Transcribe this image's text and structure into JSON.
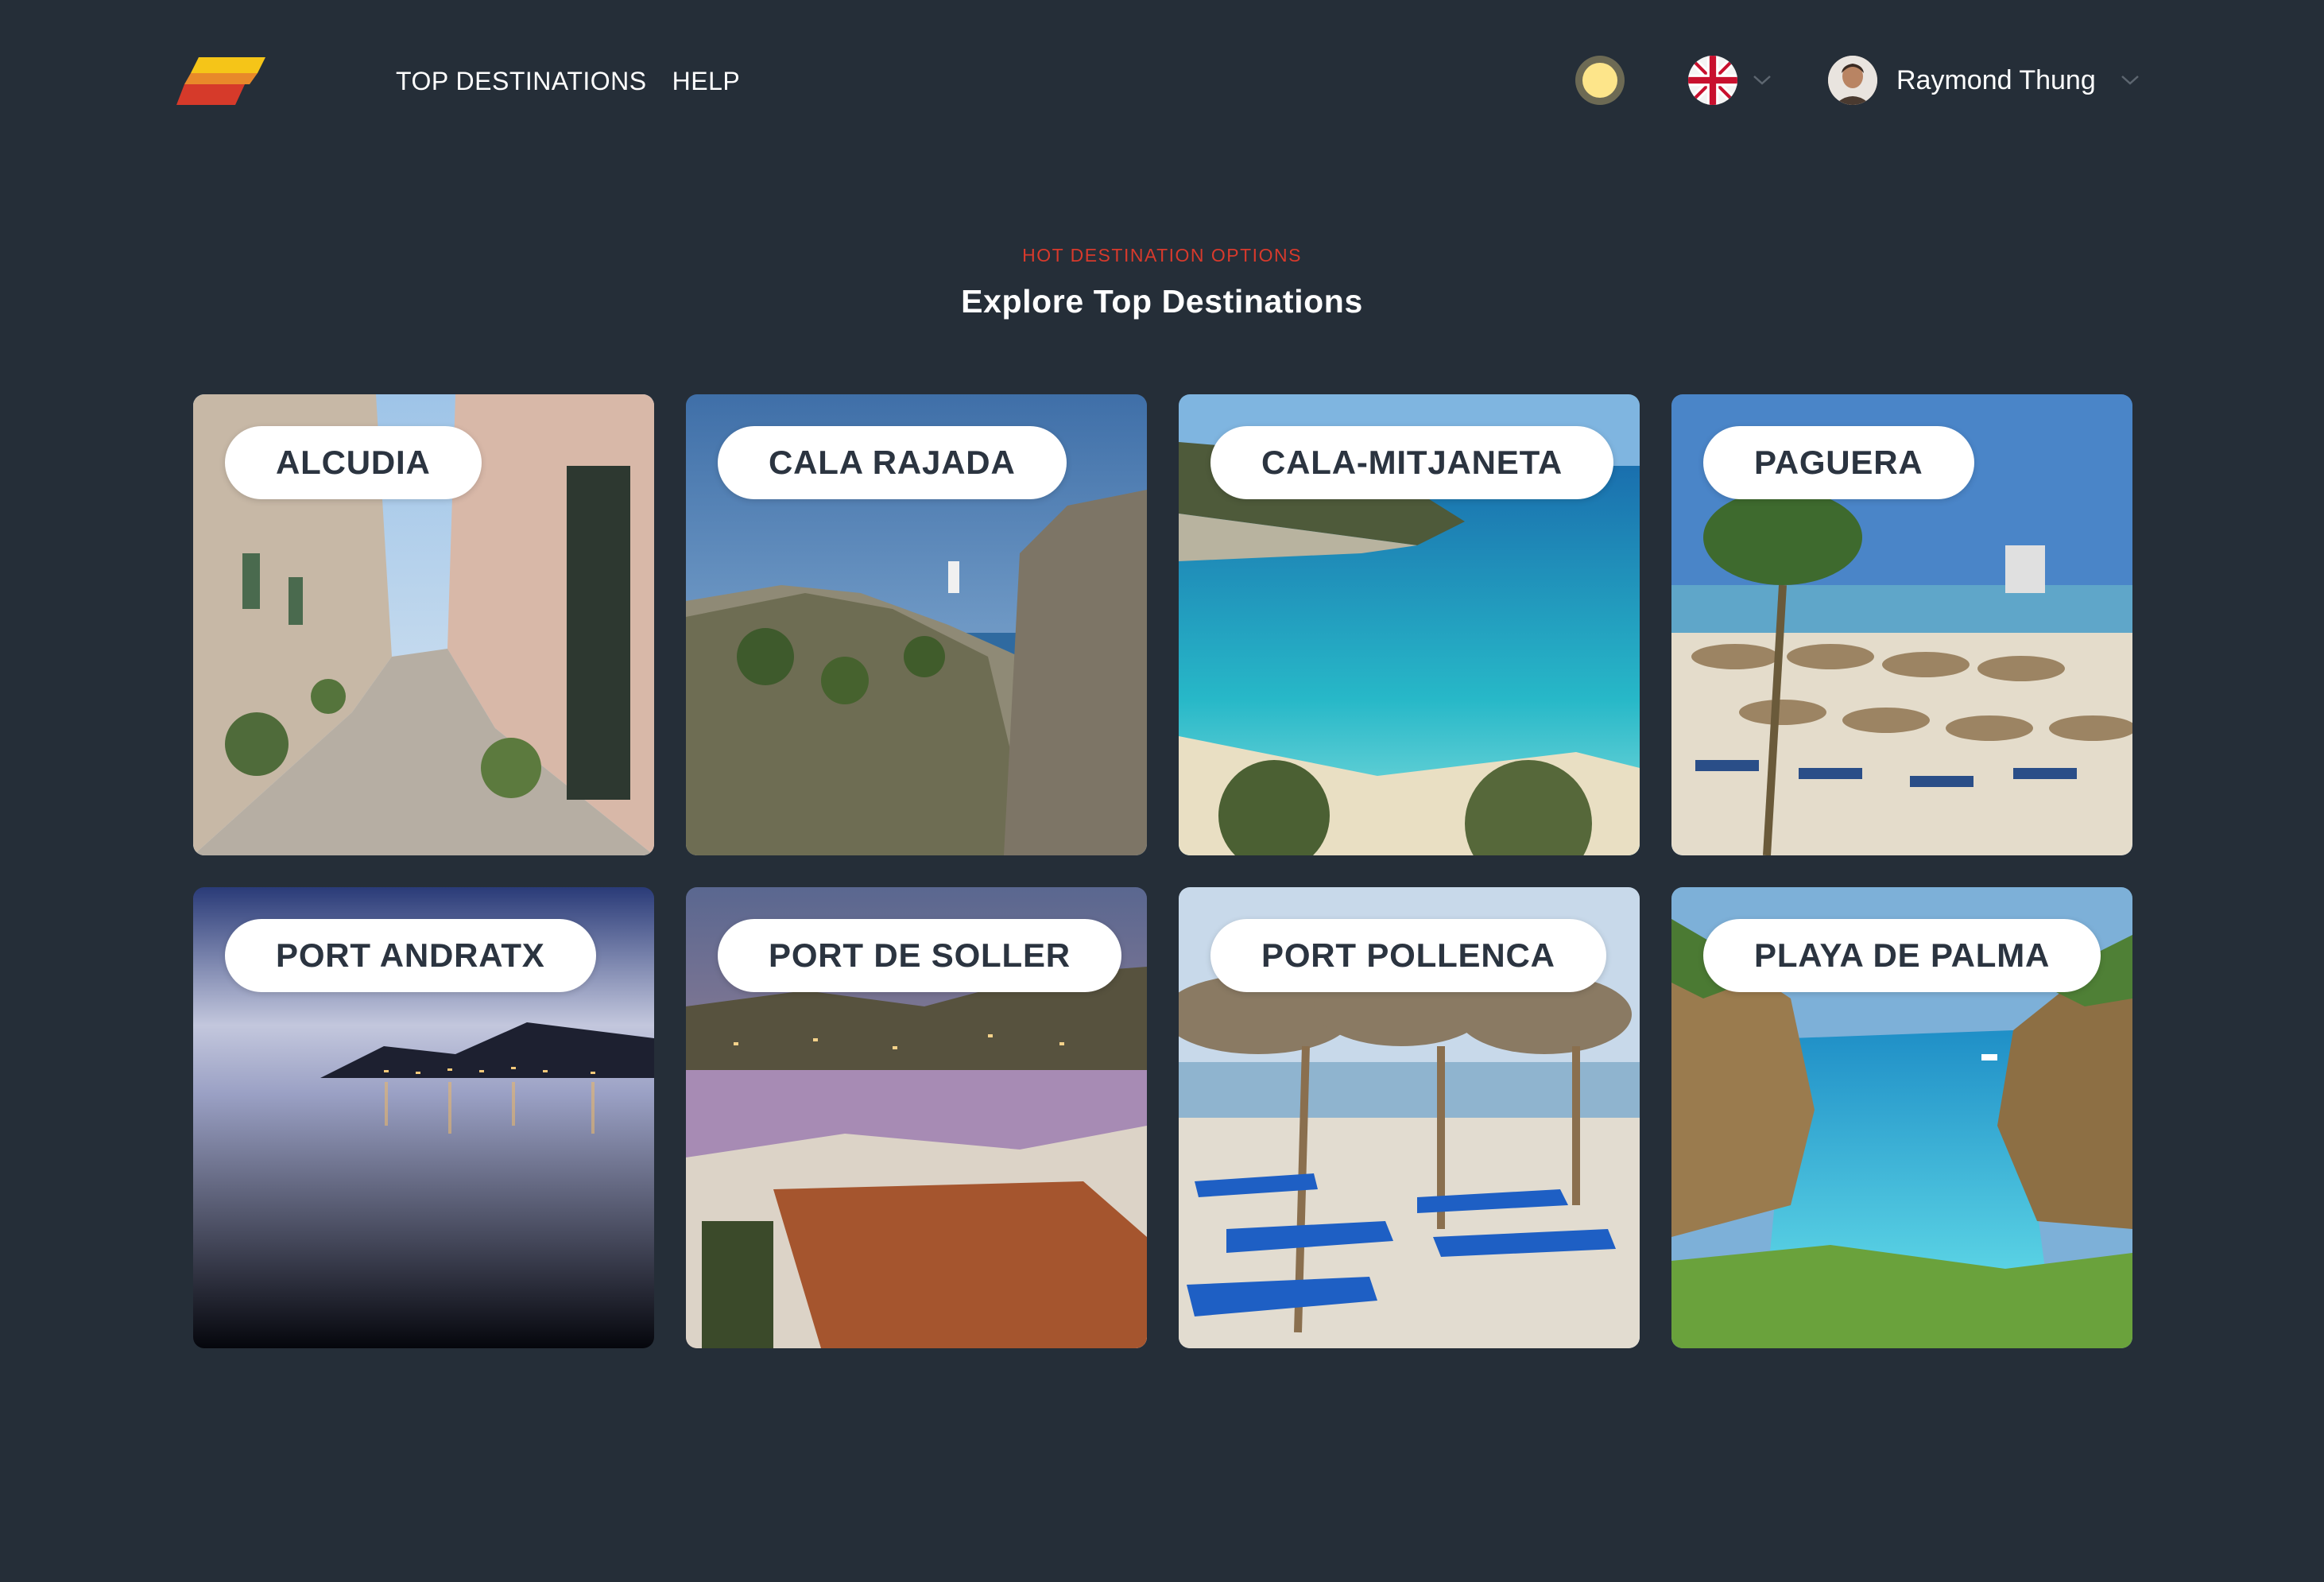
{
  "header": {
    "logo": "brand-logo",
    "nav": [
      {
        "label": "TOP DESTINATIONS"
      },
      {
        "label": "HELP"
      }
    ],
    "theme_toggle_icon": "sun-icon",
    "language": {
      "flag": "uk-flag",
      "chevron": "chevron-down-icon"
    },
    "user": {
      "name": "Raymond Thung",
      "chevron": "chevron-down-icon"
    }
  },
  "section": {
    "eyebrow": "HOT DESTINATION OPTIONS",
    "title": "Explore Top Destinations"
  },
  "destinations": [
    {
      "name": "ALCUDIA"
    },
    {
      "name": "CALA RAJADA"
    },
    {
      "name": "CALA-MITJANETA"
    },
    {
      "name": "PAGUERA"
    },
    {
      "name": "PORT ANDRATX"
    },
    {
      "name": "PORT DE SOLLER"
    },
    {
      "name": "PORT POLLENCA"
    },
    {
      "name": "PLAYA DE PALMA"
    }
  ],
  "colors": {
    "background": "#252e38",
    "accent": "#d83a2c",
    "logo_yellow": "#f5c518",
    "logo_red": "#d63a2a"
  }
}
